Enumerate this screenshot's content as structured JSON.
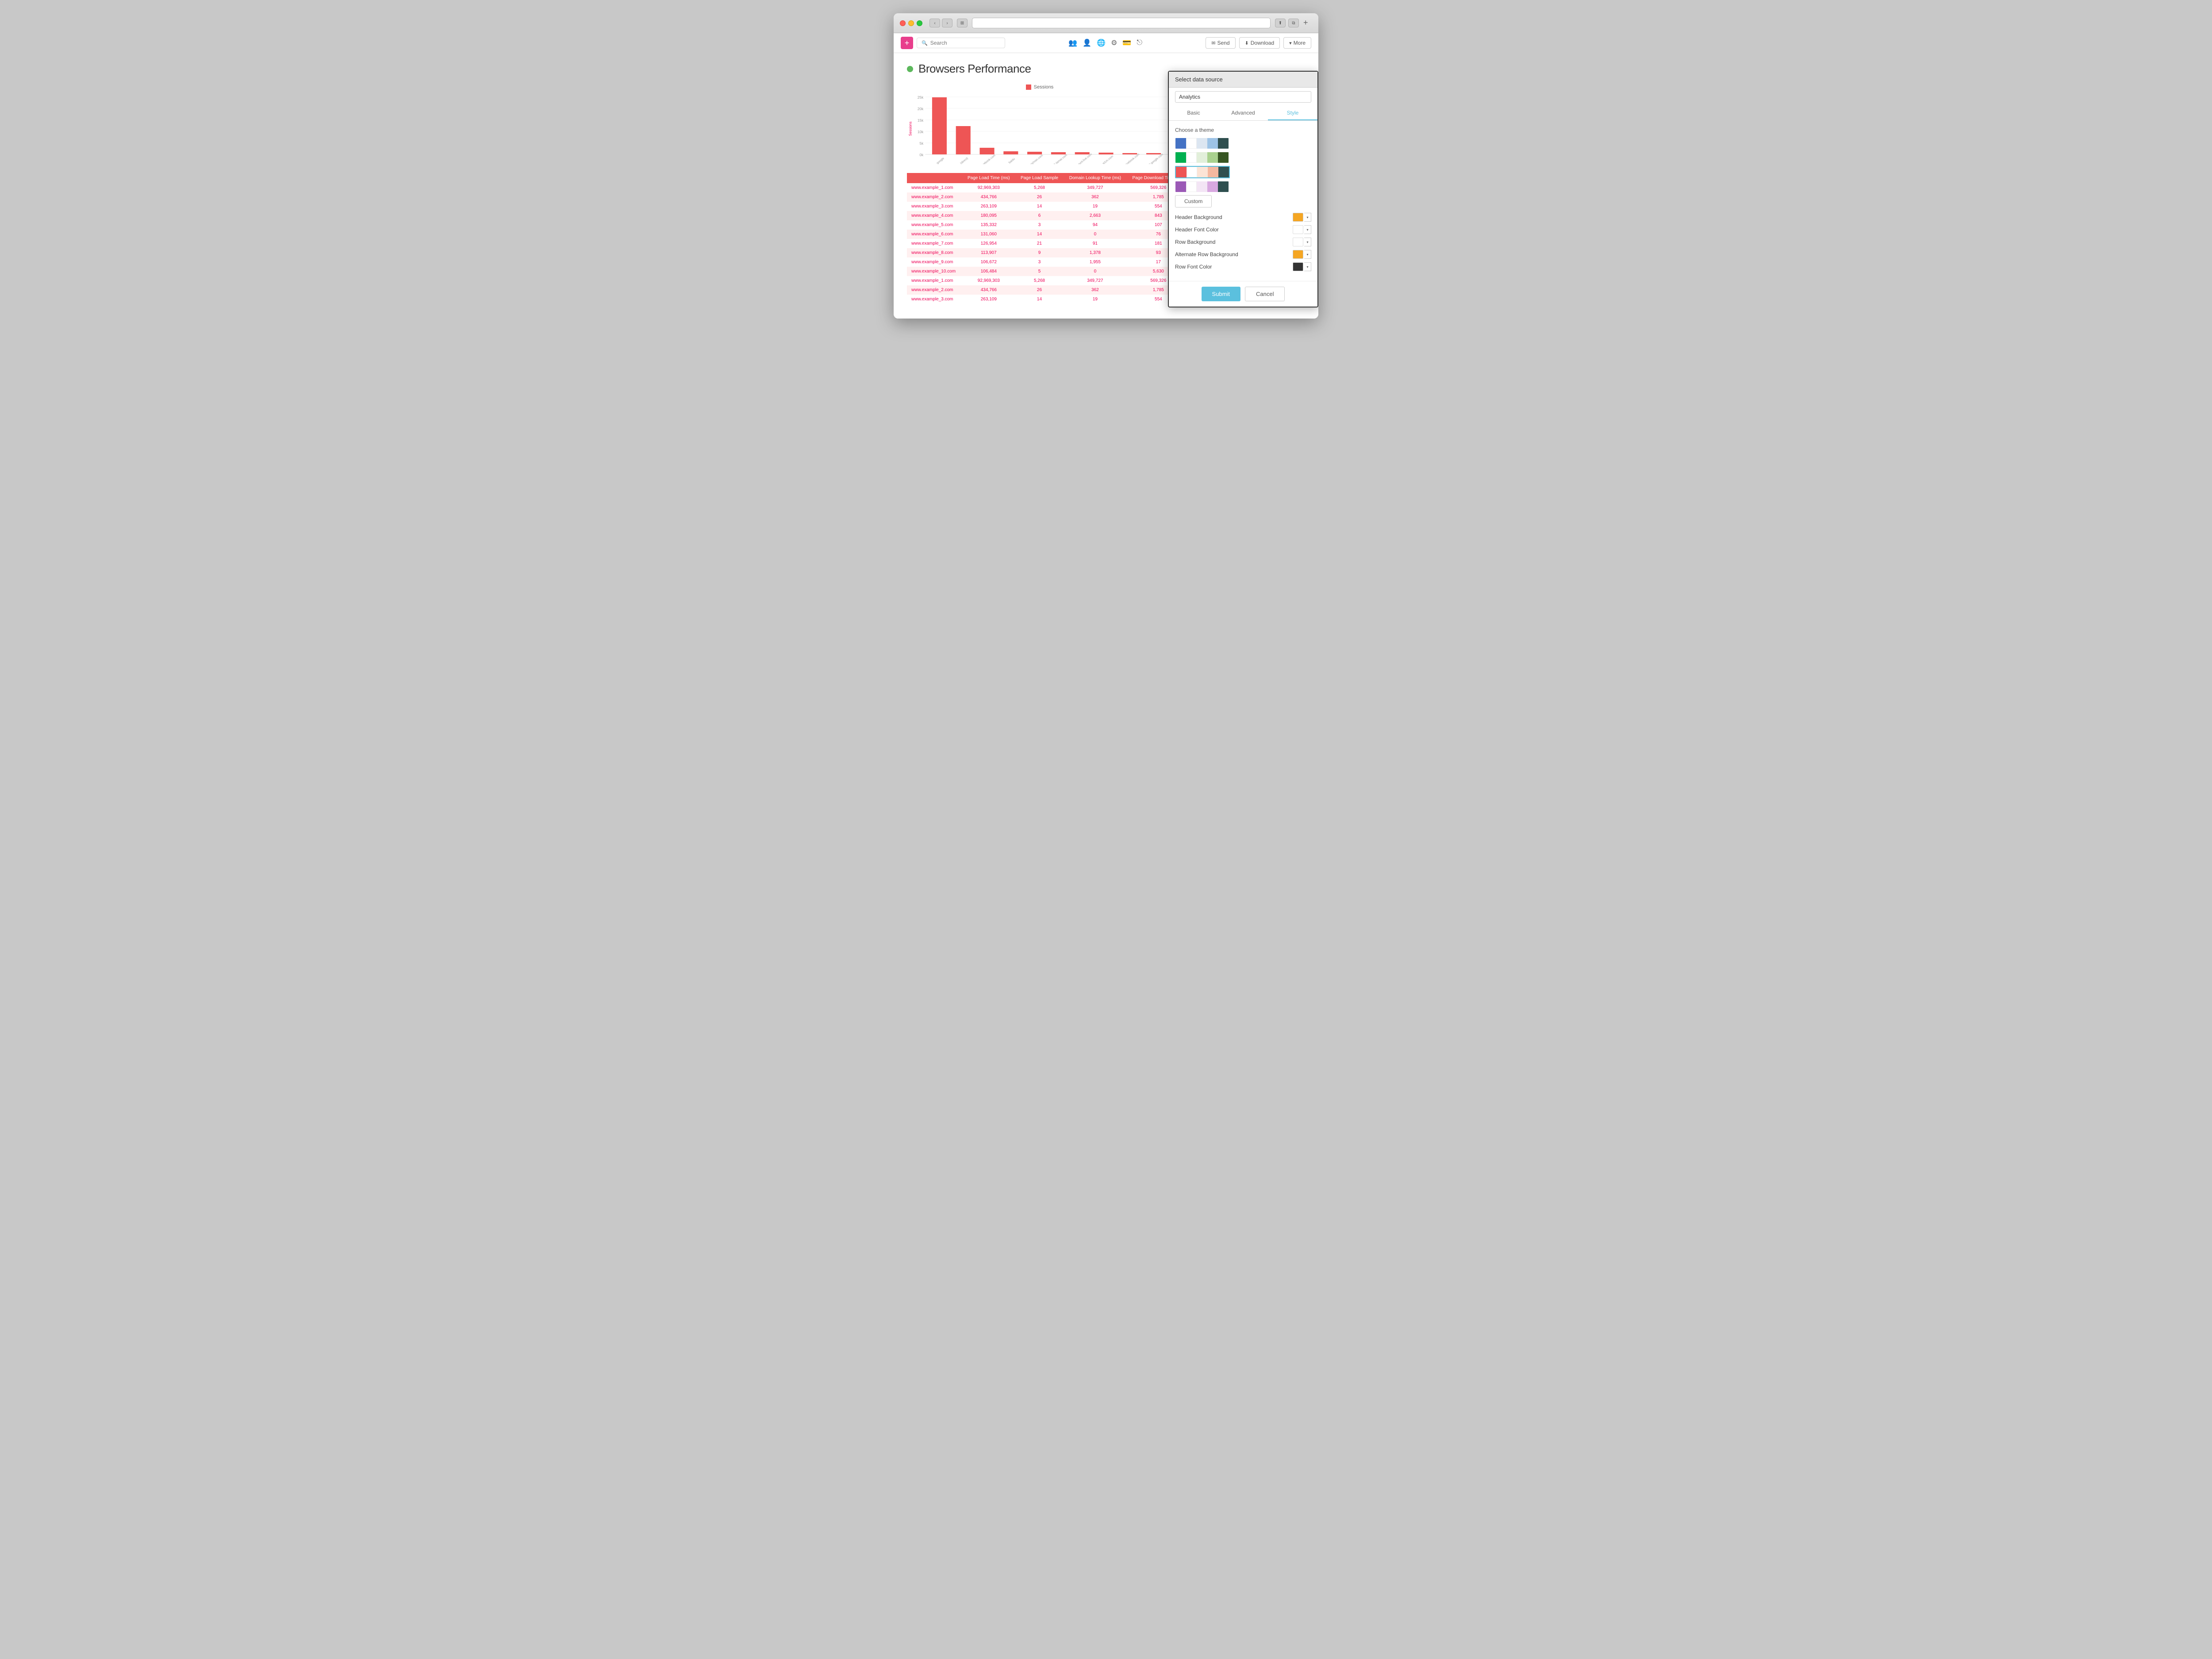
{
  "browser": {
    "url": ""
  },
  "toolbar": {
    "add_label": "+",
    "search_placeholder": "Search",
    "send_label": "Send",
    "download_label": "Download",
    "more_label": "More"
  },
  "page": {
    "title": "Browsers Performance",
    "status": "active"
  },
  "chart": {
    "legend_label": "Sessions",
    "y_labels": [
      "25k",
      "20k",
      "15k",
      "10k",
      "5k",
      "0k"
    ],
    "bars": [
      {
        "label": "google",
        "value": 22000,
        "height": 88
      },
      {
        "label": "(direct)",
        "value": 11000,
        "height": 44
      },
      {
        "label": "facebook.com",
        "value": 2500,
        "height": 10
      },
      {
        "label": "baidu",
        "value": 1200,
        "height": 5
      },
      {
        "label": "bing/msn.com",
        "value": 800,
        "height": 3
      },
      {
        "label": "sp1-lamar.com",
        "value": 600,
        "height": 2
      },
      {
        "label": "account.live.com",
        "value": 500,
        "height": 2
      },
      {
        "label": "1.st1m.com",
        "value": 400,
        "height": 2
      },
      {
        "label": "m.facebook.com",
        "value": 300,
        "height": 1
      },
      {
        "label": "mail.google.com",
        "value": 200,
        "height": 1
      }
    ]
  },
  "table": {
    "headers": [
      "",
      "Page Load Time (ms)",
      "Page Load Sample",
      "Domain Lookup Time (ms)",
      "Page Download Time (ms)"
    ],
    "rows": [
      [
        "www.example_1.com",
        "92,969,303",
        "5,268",
        "349,727",
        "569,326"
      ],
      [
        "www.example_2.com",
        "434,766",
        "26",
        "362",
        "1,785"
      ],
      [
        "www.example_3.com",
        "263,109",
        "14",
        "19",
        "554"
      ],
      [
        "www.example_4.com",
        "180,095",
        "6",
        "2,663",
        "843"
      ],
      [
        "www.example_5.com",
        "135,332",
        "3",
        "94",
        "107"
      ],
      [
        "www.example_6.com",
        "131,060",
        "14",
        "0",
        "76"
      ],
      [
        "www.example_7.com",
        "126,954",
        "21",
        "91",
        "181"
      ],
      [
        "www.example_8.com",
        "113,907",
        "9",
        "1,378",
        "93"
      ],
      [
        "www.example_9.com",
        "106,672",
        "3",
        "1,955",
        "17"
      ],
      [
        "www.example_10.com",
        "106,484",
        "5",
        "0",
        "5,630"
      ],
      [
        "www.example_1.com",
        "92,969,303",
        "5,268",
        "349,727",
        "569,326"
      ],
      [
        "www.example_2.com",
        "434,766",
        "26",
        "362",
        "1,785"
      ],
      [
        "www.example_3.com",
        "263,109",
        "14",
        "19",
        "554"
      ]
    ]
  },
  "modal": {
    "title": "Select data source",
    "datasource_options": [
      "Analytics"
    ],
    "datasource_selected": "Analytics",
    "tabs": [
      {
        "label": "Basic",
        "id": "basic"
      },
      {
        "label": "Advanced",
        "id": "advanced"
      },
      {
        "label": "Style",
        "id": "style",
        "active": true
      }
    ],
    "style_section": {
      "choose_theme_label": "Choose a theme",
      "themes": [
        {
          "colors": [
            "#4472c4",
            "#ffffff",
            "#dce6f1",
            "#c5d9f1",
            "#2f4f4f"
          ],
          "selected": false
        },
        {
          "colors": [
            "#00b050",
            "#ffffff",
            "#e2efda",
            "#c6efce",
            "#375623"
          ],
          "selected": false
        },
        {
          "colors": [
            "#e55",
            "#ffffff",
            "#fce4d6",
            "#fcd5c0",
            "#2f4f4f"
          ],
          "selected": true
        },
        {
          "colors": [
            "#9b59b6",
            "#ffffff",
            "#f3e5f5",
            "#e1bee7",
            "#2f4f4f"
          ],
          "selected": false
        }
      ],
      "custom_label": "Custom",
      "color_options": [
        {
          "label": "Header Background",
          "color": "#f5a623",
          "id": "header-bg"
        },
        {
          "label": "Header Font Color",
          "color": "#ffffff",
          "id": "header-font"
        },
        {
          "label": "Row Background",
          "color": "#ffffff",
          "id": "row-bg"
        },
        {
          "label": "Alternate Row Background",
          "color": "#f5a623",
          "id": "alt-row-bg"
        },
        {
          "label": "Row Font Color",
          "color": "#333333",
          "id": "row-font"
        }
      ]
    },
    "submit_label": "Submit",
    "cancel_label": "Cancel"
  }
}
